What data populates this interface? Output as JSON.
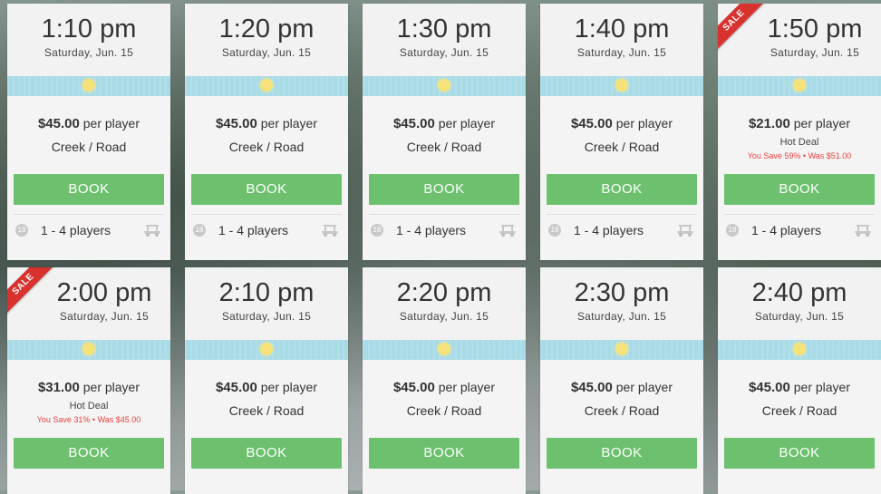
{
  "tee_times": [
    {
      "time": "1:10 pm",
      "date": "Saturday, Jun. 15",
      "price": "$45.00",
      "per": "per player",
      "course": "Creek / Road",
      "deal": null,
      "savings": null,
      "sale": false,
      "book_label": "BOOK",
      "holes": "18",
      "players": "1 - 4 players"
    },
    {
      "time": "1:20 pm",
      "date": "Saturday, Jun. 15",
      "price": "$45.00",
      "per": "per player",
      "course": "Creek / Road",
      "deal": null,
      "savings": null,
      "sale": false,
      "book_label": "BOOK",
      "holes": "18",
      "players": "1 - 4 players"
    },
    {
      "time": "1:30 pm",
      "date": "Saturday, Jun. 15",
      "price": "$45.00",
      "per": "per player",
      "course": "Creek / Road",
      "deal": null,
      "savings": null,
      "sale": false,
      "book_label": "BOOK",
      "holes": "18",
      "players": "1 - 4 players"
    },
    {
      "time": "1:40 pm",
      "date": "Saturday, Jun. 15",
      "price": "$45.00",
      "per": "per player",
      "course": "Creek / Road",
      "deal": null,
      "savings": null,
      "sale": false,
      "book_label": "BOOK",
      "holes": "18",
      "players": "1 - 4 players"
    },
    {
      "time": "1:50 pm",
      "date": "Saturday, Jun. 15",
      "price": "$21.00",
      "per": "per player",
      "course": null,
      "deal": "Hot Deal",
      "savings": "You Save 59% • Was $51.00",
      "sale": true,
      "sale_label": "SALE",
      "book_label": "BOOK",
      "holes": "18",
      "players": "1 - 4 players"
    },
    {
      "time": "2:00 pm",
      "date": "Saturday, Jun. 15",
      "price": "$31.00",
      "per": "per player",
      "course": null,
      "deal": "Hot Deal",
      "savings": "You Save 31% • Was $45.00",
      "sale": true,
      "sale_label": "SALE",
      "book_label": "BOOK",
      "holes": null,
      "players": null
    },
    {
      "time": "2:10 pm",
      "date": "Saturday, Jun. 15",
      "price": "$45.00",
      "per": "per player",
      "course": "Creek / Road",
      "deal": null,
      "savings": null,
      "sale": false,
      "book_label": "BOOK",
      "holes": null,
      "players": null
    },
    {
      "time": "2:20 pm",
      "date": "Saturday, Jun. 15",
      "price": "$45.00",
      "per": "per player",
      "course": "Creek / Road",
      "deal": null,
      "savings": null,
      "sale": false,
      "book_label": "BOOK",
      "holes": null,
      "players": null
    },
    {
      "time": "2:30 pm",
      "date": "Saturday, Jun. 15",
      "price": "$45.00",
      "per": "per player",
      "course": "Creek / Road",
      "deal": null,
      "savings": null,
      "sale": false,
      "book_label": "BOOK",
      "holes": null,
      "players": null
    },
    {
      "time": "2:40 pm",
      "date": "Saturday, Jun. 15",
      "price": "$45.00",
      "per": "per player",
      "course": "Creek / Road",
      "deal": null,
      "savings": null,
      "sale": false,
      "book_label": "BOOK",
      "holes": null,
      "players": null
    }
  ],
  "colors": {
    "book": "#6cc06e",
    "sale_ribbon": "#d8322f",
    "weather_band": "#a9dbe6",
    "savings_text": "#e8413d"
  },
  "icons": {
    "weather": "sun-icon",
    "holes": "holes-badge-icon",
    "cart": "golf-cart-icon"
  }
}
